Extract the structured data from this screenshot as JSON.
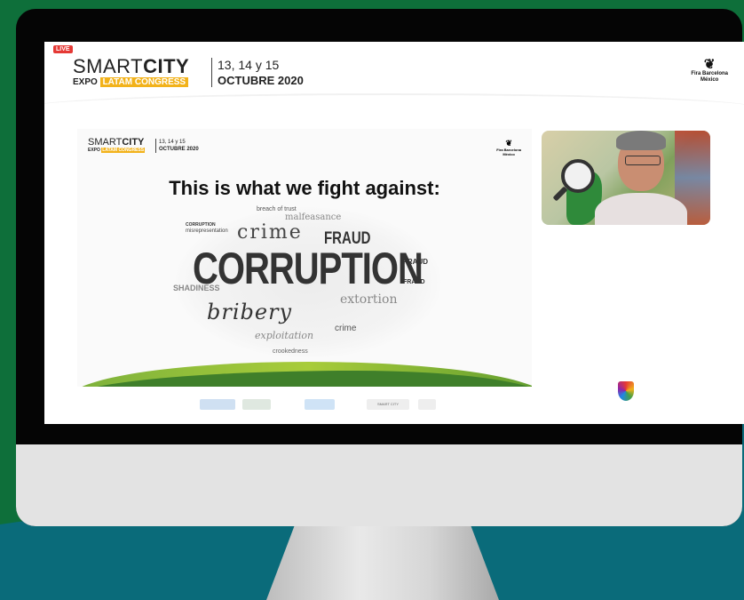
{
  "header": {
    "live": "LIVE",
    "brand_smart": "SMART",
    "brand_city": "CITY",
    "brand_expo": "EXPO",
    "brand_latam": "LATAM CONGRESS",
    "dates_line1": "13, 14 y 15",
    "dates_line2": "OCTUBRE 2020",
    "sponsor_name": "Fira Barcelona",
    "sponsor_country": "México"
  },
  "slide": {
    "brand_smart": "SMART",
    "brand_city": "CITY",
    "brand_expo": "EXPO",
    "brand_latam": "LATAM CONGRESS",
    "dates_line1": "13, 14 y 15",
    "dates_line2": "OCTUBRE 2020",
    "sponsor_name": "Fira Barcelona",
    "sponsor_country": "México",
    "heading": "This is what we fight against:",
    "word_cloud": {
      "corruption": "CORRUPTION",
      "crime": "crime",
      "fraud": "FRAUD",
      "bribery": "bribery",
      "extortion": "extortion",
      "exploitation": "exploitation",
      "crime2": "crime",
      "malfeasance": "malfeasance",
      "breach": "breach of trust",
      "misrepresentation": "misrepresentation",
      "shadiness": "SHADINESS",
      "crookedness": "crookedness",
      "corruption_small": "CORRUPTION"
    }
  },
  "sponsors": {
    "sponsor_logo_name": "SMART CITY"
  },
  "icons": [
    "magnifier-icon",
    "fira-logo-icon",
    "collab-logo-icon"
  ],
  "colors": {
    "brand_yellow": "#f2b21a",
    "live_red": "#e53935",
    "slide_green": "#7bb03b",
    "background_green": "#0e6f3a",
    "background_teal": "#0a6b7a"
  }
}
